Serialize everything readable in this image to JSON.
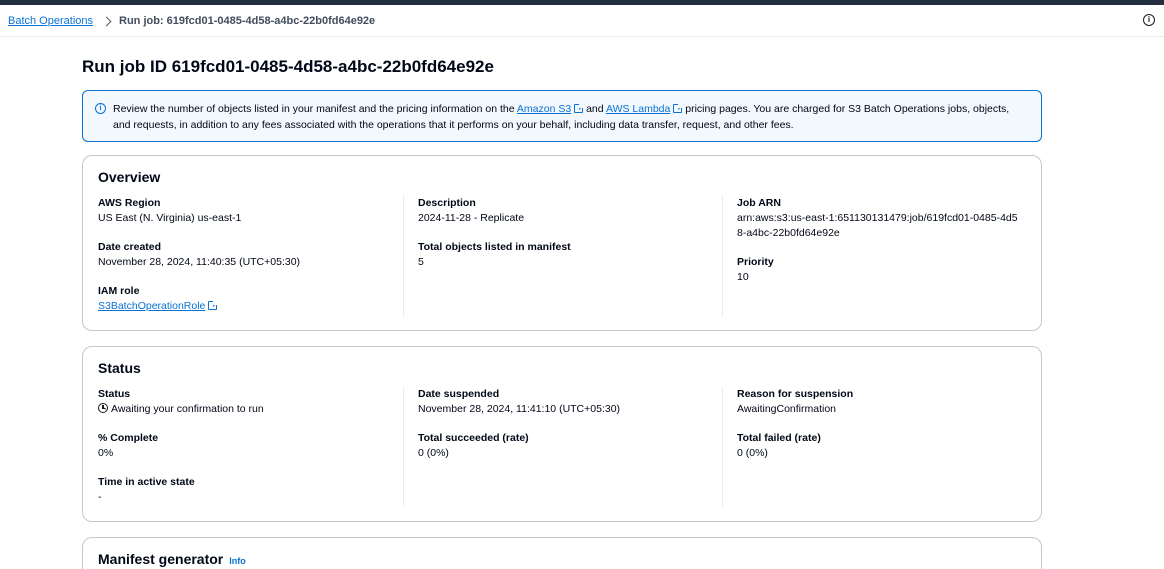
{
  "breadcrumb": {
    "parent": "Batch Operations",
    "current": "Run job: 619fcd01-0485-4d58-a4bc-22b0fd64e92e"
  },
  "help_icon": "info-circle-icon",
  "page_title": "Run job ID 619fcd01-0485-4d58-a4bc-22b0fd64e92e",
  "alert": {
    "text_1": "Review the number of objects listed in your manifest and the pricing information on the ",
    "link_1": "Amazon S3",
    "text_2": " and ",
    "link_2": "AWS Lambda",
    "text_3": " pricing pages. You are charged for S3 Batch Operations jobs, objects, and requests, in addition to any fees associated with the operations that it performs on your behalf, including data transfer, request, and other fees."
  },
  "overview": {
    "title": "Overview",
    "aws_region_label": "AWS Region",
    "aws_region_value": "US East (N. Virginia) us-east-1",
    "date_created_label": "Date created",
    "date_created_value": "November 28, 2024, 11:40:35 (UTC+05:30)",
    "iam_role_label": "IAM role",
    "iam_role_value": "S3BatchOperationRole",
    "description_label": "Description",
    "description_value": "2024-11-28 - Replicate",
    "total_objects_label": "Total objects listed in manifest",
    "total_objects_value": "5",
    "job_arn_label": "Job ARN",
    "job_arn_value": "arn:aws:s3:us-east-1:651130131479:job/619fcd01-0485-4d58-a4bc-22b0fd64e92e",
    "priority_label": "Priority",
    "priority_value": "10"
  },
  "status": {
    "title": "Status",
    "status_label": "Status",
    "status_value": "Awaiting your confirmation to run",
    "percent_complete_label": "% Complete",
    "percent_complete_value": "0%",
    "time_active_label": "Time in active state",
    "time_active_value": "-",
    "date_suspended_label": "Date suspended",
    "date_suspended_value": "November 28, 2024, 11:41:10 (UTC+05:30)",
    "total_succeeded_label": "Total succeeded (rate)",
    "total_succeeded_value": "0 (0%)",
    "reason_label": "Reason for suspension",
    "reason_value": "AwaitingConfirmation",
    "total_failed_label": "Total failed (rate)",
    "total_failed_value": "0 (0%)"
  },
  "manifest": {
    "title": "Manifest generator",
    "info_link": "Info"
  }
}
